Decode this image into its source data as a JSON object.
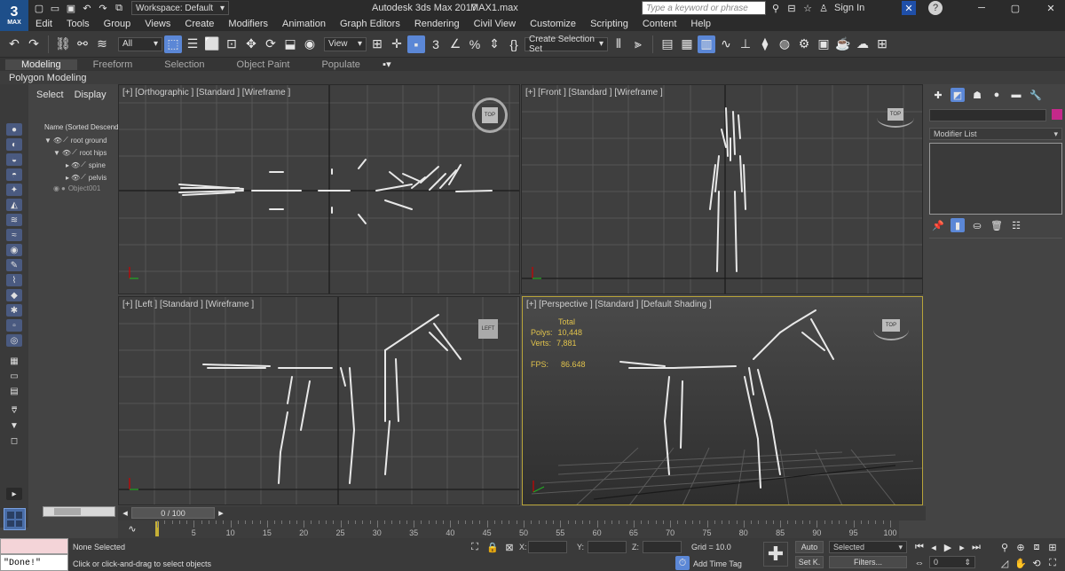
{
  "title_bar": {
    "app_logo": "3",
    "app_logo_sub": "MAX",
    "workspace": "Workspace: Default",
    "title": "Autodesk 3ds Max 2017",
    "file": "MAX1.max",
    "search_placeholder": "Type a keyword or phrase",
    "sign_in": "Sign In"
  },
  "menu": [
    "Edit",
    "Tools",
    "Group",
    "Views",
    "Create",
    "Modifiers",
    "Animation",
    "Graph Editors",
    "Rendering",
    "Civil View",
    "Customize",
    "Scripting",
    "Content",
    "Help"
  ],
  "toolbar": {
    "filter": "All",
    "ref_coord": "View",
    "selection_set": "Create Selection Set"
  },
  "ribbon": {
    "tabs": [
      "Modeling",
      "Freeform",
      "Selection",
      "Object Paint",
      "Populate"
    ],
    "sub_label": "Polygon Modeling"
  },
  "scene_explorer": {
    "tabs": [
      "Select",
      "Display"
    ],
    "header": "Name (Sorted Descend",
    "items": [
      "root ground",
      "root hips",
      "spine",
      "pelvis",
      "Object001"
    ]
  },
  "viewports": {
    "top_left": "[+] [Orthographic ] [Standard ] [Wireframe ]",
    "top_right": "[+] [Front ] [Standard ] [Wireframe ]",
    "bottom_left": "[+] [Left ] [Standard ] [Wireframe ]",
    "bottom_right": "[+] [Perspective ] [Standard ] [Default Shading ]",
    "cube_top": "TOP",
    "cube_side": "LEFT",
    "stats": {
      "total_label": "Total",
      "polys_label": "Polys:",
      "polys": "10,448",
      "verts_label": "Verts:",
      "verts": "7,881",
      "fps_label": "FPS:",
      "fps": "86.648"
    }
  },
  "command_panel": {
    "modifier_list": "Modifier List"
  },
  "timeline": {
    "frame": "0 / 100",
    "ticks": [
      "5",
      "10",
      "15",
      "20",
      "25",
      "30",
      "35",
      "40",
      "45",
      "50",
      "55",
      "60",
      "65",
      "70",
      "75",
      "80",
      "85",
      "90",
      "95",
      "100"
    ]
  },
  "status": {
    "maxscript": "\"Done!\"",
    "selected": "None Selected",
    "prompt": "Click or click-and-drag to select objects",
    "x_label": "X:",
    "y_label": "Y:",
    "z_label": "Z:",
    "grid": "Grid = 10.0",
    "add_time_tag": "Add Time Tag",
    "auto": "Auto",
    "set_key": "Set K.",
    "key_mode": "Selected",
    "filters": "Filters...",
    "current_frame": "0"
  },
  "colors": {
    "accent_blue": "#5b87d6",
    "active_viewport_border": "#b8a43a",
    "stats_yellow": "#e0c24c",
    "wireframe": "#e8e8e8"
  }
}
